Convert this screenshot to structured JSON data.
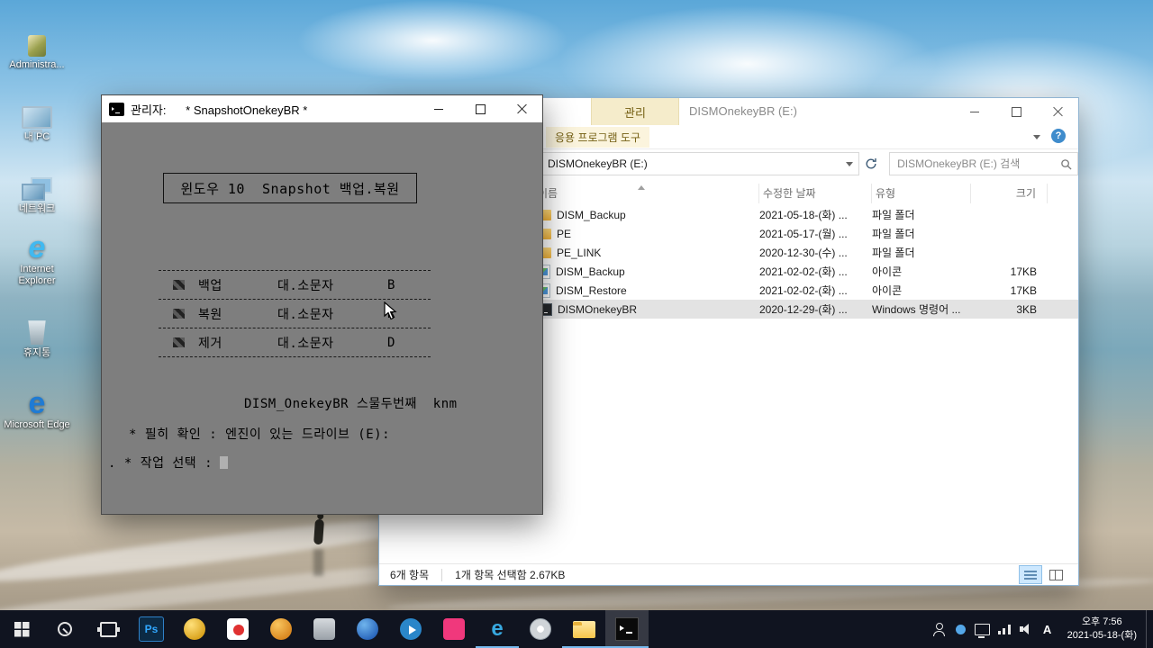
{
  "desktop": {
    "icons": [
      {
        "icon": "admin",
        "label": "Administra...",
        "glyph": ""
      },
      {
        "icon": "pc",
        "label": "내 PC",
        "glyph": ""
      },
      {
        "icon": "network",
        "label": "네트워크",
        "glyph": ""
      },
      {
        "icon": "ie",
        "label": "Internet Explorer",
        "glyph": "e"
      },
      {
        "icon": "recycle",
        "label": "휴지통",
        "glyph": ""
      },
      {
        "icon": "edge",
        "label": "Microsoft Edge",
        "glyph": "e"
      }
    ]
  },
  "cmd": {
    "title": "관리자:      * SnapshotOnekeyBR *",
    "heading": "윈도우 10  Snapshot 백업.복원",
    "menu": [
      {
        "label": "백업",
        "mid": "대.소문자",
        "key": "B"
      },
      {
        "label": "복원",
        "mid": "대.소문자",
        "key": "R"
      },
      {
        "label": "제거",
        "mid": "대.소문자",
        "key": "D"
      }
    ],
    "version_line": "DISM_OnekeyBR 스물두번째  knm",
    "note_line": "* 필히 확인 : 엔진이 있는 드라이브 (E):",
    "prompt_line": ". * 작업 선택 :"
  },
  "explorer": {
    "contextual_tab": "관리",
    "window_title": "DISMOnekeyBR (E:)",
    "tool_tab": "응용 프로그램 도구",
    "help_glyph": "?",
    "address": "DISMOnekeyBR (E:)",
    "search_placeholder": "DISMOnekeyBR (E:) 검색",
    "columns": {
      "name": "이름",
      "date": "수정한 날짜",
      "type": "유형",
      "size": "크기"
    },
    "files": [
      {
        "icon": "folder",
        "name": "DISM_Backup",
        "date": "2021-05-18-(화) ...",
        "type": "파일 폴더",
        "size": ""
      },
      {
        "icon": "folder",
        "name": "PE",
        "date": "2021-05-17-(월) ...",
        "type": "파일 폴더",
        "size": ""
      },
      {
        "icon": "folder",
        "name": "PE_LINK",
        "date": "2020-12-30-(수) ...",
        "type": "파일 폴더",
        "size": ""
      },
      {
        "icon": "file",
        "name": "DISM_Backup",
        "date": "2021-02-02-(화) ...",
        "type": "아이콘",
        "size": "17KB"
      },
      {
        "icon": "file",
        "name": "DISM_Restore",
        "date": "2021-02-02-(화) ...",
        "type": "아이콘",
        "size": "17KB"
      },
      {
        "icon": "cmd",
        "name": "DISMOnekeyBR",
        "date": "2020-12-29-(화) ...",
        "type": "Windows 명령어 ...",
        "size": "3KB",
        "selected": true
      }
    ],
    "status_items": "6개 항목",
    "status_selection": "1개 항목 선택함 2.67KB"
  },
  "taskbar": {
    "buttons": [
      {
        "icon": "windows-start"
      },
      {
        "icon": "search"
      },
      {
        "icon": "task-view"
      },
      {
        "icon": "photoshop",
        "text": "Ps"
      },
      {
        "icon": "gold-antivirus"
      },
      {
        "icon": "red-app"
      },
      {
        "icon": "orange-app"
      },
      {
        "icon": "gray-app"
      },
      {
        "icon": "blue-app"
      },
      {
        "icon": "media-app"
      },
      {
        "icon": "pink-app"
      },
      {
        "icon": "edge-browser",
        "text": "e",
        "running": true
      },
      {
        "icon": "disc-app"
      },
      {
        "icon": "file-explorer",
        "running": true
      },
      {
        "icon": "command-prompt",
        "running": true,
        "focused": true
      }
    ],
    "tray": [
      {
        "icon": "user"
      },
      {
        "icon": "app-dot"
      },
      {
        "icon": "display"
      },
      {
        "icon": "network"
      },
      {
        "icon": "volume"
      },
      {
        "icon": "ime",
        "text": "A"
      }
    ],
    "clock": {
      "time": "오후 7:56",
      "date": "2021-05-18-(화)"
    }
  }
}
